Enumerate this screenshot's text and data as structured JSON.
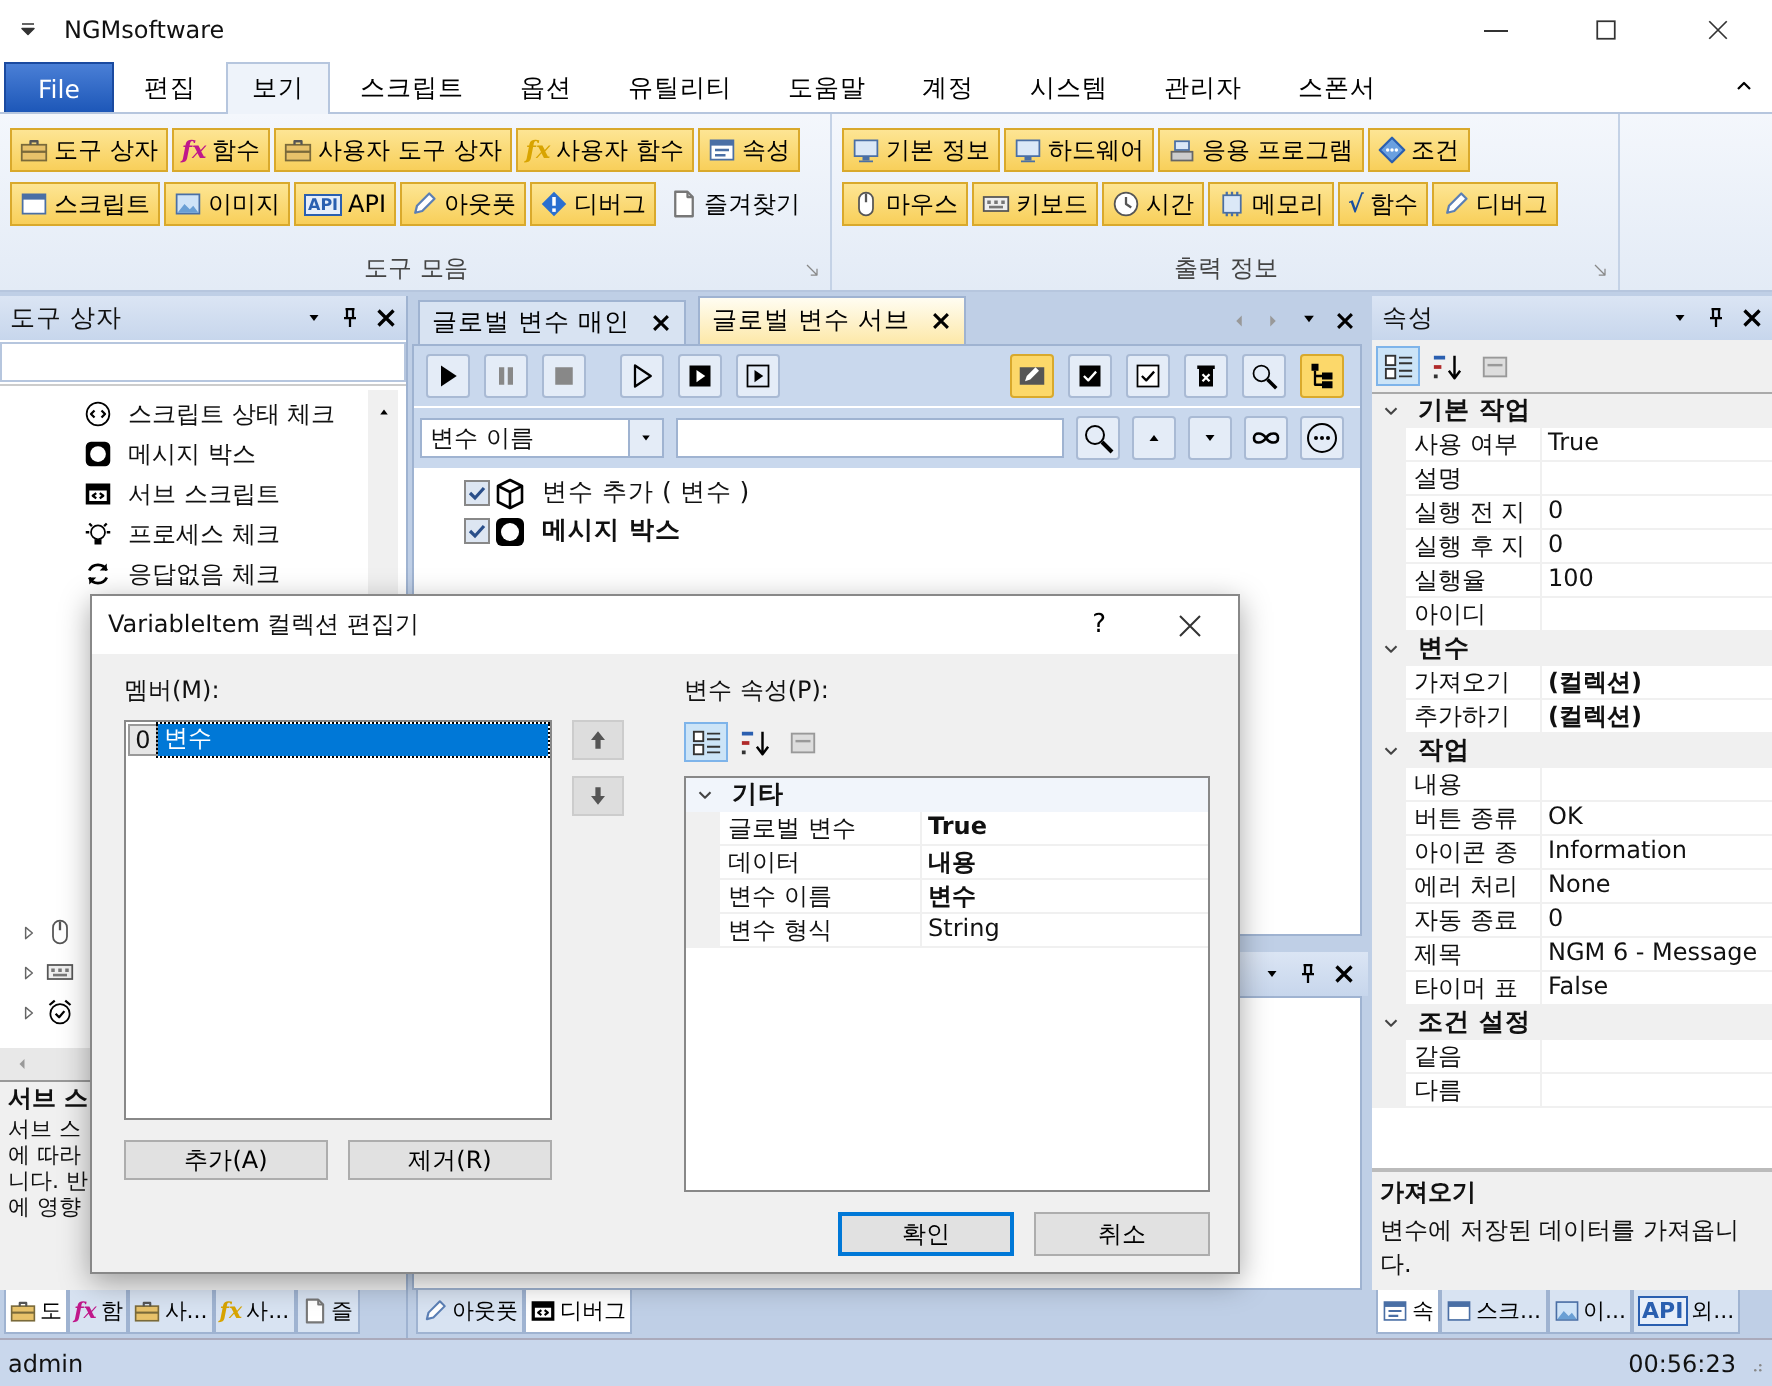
{
  "window": {
    "title": "NGMsoftware"
  },
  "ribbon_tabs": [
    {
      "label": "File",
      "kind": "file",
      "selected": false
    },
    {
      "label": "편집",
      "kind": "tab",
      "selected": false
    },
    {
      "label": "보기",
      "kind": "tab",
      "selected": true
    },
    {
      "label": "스크립트",
      "kind": "tab",
      "selected": false
    },
    {
      "label": "옵션",
      "kind": "tab",
      "selected": false
    },
    {
      "label": "유틸리티",
      "kind": "tab",
      "selected": false
    },
    {
      "label": "도움말",
      "kind": "tab",
      "selected": false
    },
    {
      "label": "계정",
      "kind": "tab",
      "selected": false
    },
    {
      "label": "시스템",
      "kind": "tab",
      "selected": false
    },
    {
      "label": "관리자",
      "kind": "tab",
      "selected": false
    },
    {
      "label": "스폰서",
      "kind": "tab",
      "selected": false
    }
  ],
  "ribbon_groups": [
    {
      "title": "도구 모음",
      "rows": [
        {
          "buttons": [
            {
              "label": "도구 상자",
              "checked": true
            },
            {
              "label": "함수",
              "checked": true,
              "glyph": "fx",
              "color": "#c0188a"
            },
            {
              "label": "사용자 도구 상자",
              "checked": true
            },
            {
              "label": "사용자 함수",
              "checked": true,
              "glyph": "fx",
              "color": "#d8a400"
            },
            {
              "label": "속성",
              "checked": true
            }
          ]
        },
        {
          "buttons": [
            {
              "label": "스크립트",
              "checked": true
            },
            {
              "label": "이미지",
              "checked": true
            },
            {
              "label": "API",
              "checked": true,
              "glyph": "API",
              "color": "#2a5fb0"
            },
            {
              "label": "아웃풋",
              "checked": true
            },
            {
              "label": "디버그",
              "checked": true
            },
            {
              "label": "즐겨찾기",
              "checked": false
            }
          ]
        }
      ]
    },
    {
      "title": "출력 정보",
      "rows": [
        {
          "buttons": [
            {
              "label": "기본 정보",
              "checked": true
            },
            {
              "label": "하드웨어",
              "checked": true
            },
            {
              "label": "응용 프로그램",
              "checked": true
            },
            {
              "label": "조건",
              "checked": true
            }
          ]
        },
        {
          "buttons": [
            {
              "label": "마우스",
              "checked": true
            },
            {
              "label": "키보드",
              "checked": true
            },
            {
              "label": "시간",
              "checked": true
            },
            {
              "label": "메모리",
              "checked": true
            },
            {
              "label": "함수",
              "checked": true,
              "glyph": "√",
              "color": "#1a4fa0"
            },
            {
              "label": "디버그",
              "checked": true
            }
          ]
        }
      ]
    }
  ],
  "toolbox": {
    "title": "도구 상자",
    "items": [
      {
        "label": "스크립트 상태 체크"
      },
      {
        "label": "메시지 박스"
      },
      {
        "label": "서브 스크립트"
      },
      {
        "label": "프로세스 체크"
      },
      {
        "label": "응답없음 체크"
      }
    ],
    "description": {
      "title": "서브 스",
      "lines": [
        "서브 스",
        "에 따라",
        "니다. 반",
        "에 영향"
      ]
    },
    "tabs": [
      {
        "label": "도",
        "selected": true
      },
      {
        "label": "함",
        "glyph": "fx",
        "color": "#c0188a",
        "selected": false
      },
      {
        "label": "사...",
        "selected": false
      },
      {
        "label": "사...",
        "glyph": "fx",
        "color": "#d8a400",
        "selected": false
      },
      {
        "label": "즐",
        "selected": false
      }
    ]
  },
  "documents": {
    "tabs": [
      {
        "label": "글로벌 변수 매인",
        "selected": false
      },
      {
        "label": "글로벌 변수 서브",
        "selected": true
      }
    ],
    "toolbar": [
      {
        "highlighted": false
      },
      {
        "highlighted": false
      },
      {
        "highlighted": false
      },
      {
        "highlighted": false
      },
      {
        "highlighted": false
      },
      {
        "highlighted": false
      },
      {
        "highlighted": true
      },
      {
        "highlighted": false
      },
      {
        "highlighted": false
      },
      {
        "highlighted": false
      },
      {
        "highlighted": false
      },
      {
        "highlighted": true
      }
    ],
    "search_by": "변수 이름",
    "tree": [
      {
        "label": "변수 추가 ( 변수 )",
        "checked": true,
        "bold": false
      },
      {
        "label": "메시지 박스",
        "checked": true,
        "bold": true
      }
    ]
  },
  "output_tabs": [
    {
      "label": "아웃풋",
      "selected": false
    },
    {
      "label": "디버그",
      "selected": true
    }
  ],
  "properties": {
    "title": "속성",
    "categories": [
      {
        "title": "기본 작업",
        "expanded": true,
        "rows": [
          {
            "name": "사용 여부",
            "value": "True"
          },
          {
            "name": "설명"
          },
          {
            "name": "실행 전 지",
            "value": "0"
          },
          {
            "name": "실행 후 지",
            "value": "0"
          },
          {
            "name": "실행율",
            "value": "100"
          },
          {
            "name": "아이디"
          }
        ]
      },
      {
        "title": "변수",
        "expanded": true,
        "rows": [
          {
            "name": "가져오기",
            "value": "(컬렉션)",
            "bold": true
          },
          {
            "name": "추가하기",
            "value": "(컬렉션)",
            "bold": true
          }
        ]
      },
      {
        "title": "작업",
        "expanded": true,
        "rows": [
          {
            "name": "내용"
          },
          {
            "name": "버튼 종류",
            "value": "OK"
          },
          {
            "name": "아이콘 종",
            "value": "Information"
          },
          {
            "name": "에러 처리",
            "value": "None"
          },
          {
            "name": "자동 종료",
            "value": "0"
          },
          {
            "name": "제목",
            "value": "NGM 6 - Message"
          },
          {
            "name": "타이머 표",
            "value": "False"
          }
        ]
      },
      {
        "title": "조건 설정",
        "expanded": true,
        "rows": [
          {
            "name": "같음"
          },
          {
            "name": "다름"
          }
        ]
      }
    ],
    "description": {
      "title": "가져오기",
      "text": "변수에 저장된 데이터를 가져옵니다."
    },
    "tabs": [
      {
        "label": "속",
        "selected": true
      },
      {
        "label": "스크...",
        "selected": false
      },
      {
        "label": "이...",
        "selected": false
      },
      {
        "label": "외...",
        "glyph": "API",
        "color": "#2a5fb0",
        "selected": false
      }
    ]
  },
  "dialog": {
    "title": "VariableItem 컬렉션 편집기",
    "help": "?",
    "members_label": "멤버(M):",
    "members": [
      {
        "index": "0",
        "label": "변수",
        "selected": true
      }
    ],
    "add": "추가(A)",
    "remove": "제거(R)",
    "props_label": "변수 속성(P):",
    "category": {
      "title": "기타",
      "expanded": true,
      "rows": [
        {
          "name": "글로벌 변수",
          "value": "True",
          "bold": true
        },
        {
          "name": "데이터",
          "value": "내용",
          "bold": true
        },
        {
          "name": "변수 이름",
          "value": "변수",
          "bold": true
        },
        {
          "name": "변수 형식",
          "value": "String"
        }
      ]
    },
    "ok": "확인",
    "cancel": "취소"
  },
  "status_bar": {
    "user": "admin",
    "time": "00:56:23"
  }
}
